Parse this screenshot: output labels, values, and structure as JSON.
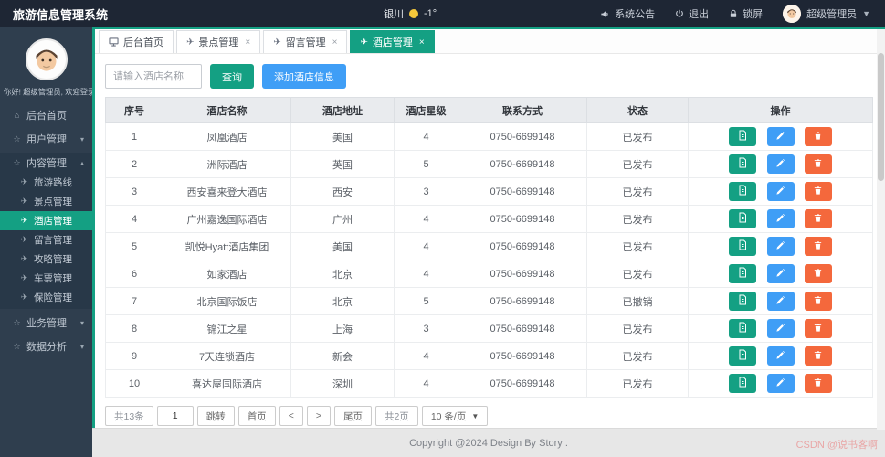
{
  "header": {
    "title": "旅游信息管理系统",
    "city": "银川",
    "weather_icon": "sun",
    "temperature": "-1°",
    "announcement_label": "系统公告",
    "logout_label": "退出",
    "lock_label": "锁屏",
    "username": "超级管理员"
  },
  "sidebar": {
    "greeting": "你好! 超级管理员, 欢迎登录",
    "menu": [
      {
        "label": "后台首页",
        "icon": "home-icon",
        "caret": ""
      },
      {
        "label": "用户管理",
        "icon": "folder-icon",
        "caret": "down"
      },
      {
        "label": "内容管理",
        "icon": "folder-icon",
        "caret": "up",
        "expanded": true,
        "children": [
          {
            "label": "旅游路线",
            "active": false
          },
          {
            "label": "景点管理",
            "active": false
          },
          {
            "label": "酒店管理",
            "active": true
          },
          {
            "label": "留言管理",
            "active": false
          },
          {
            "label": "攻略管理",
            "active": false
          },
          {
            "label": "车票管理",
            "active": false
          },
          {
            "label": "保险管理",
            "active": false
          }
        ]
      },
      {
        "label": "业务管理",
        "icon": "folder-icon",
        "caret": "down"
      },
      {
        "label": "数据分析",
        "icon": "folder-icon",
        "caret": "down"
      }
    ]
  },
  "tabs": [
    {
      "label": "后台首页",
      "icon": "monitor",
      "closable": false,
      "active": false
    },
    {
      "label": "景点管理",
      "icon": "plane",
      "closable": true,
      "active": false
    },
    {
      "label": "留言管理",
      "icon": "plane",
      "closable": true,
      "active": false
    },
    {
      "label": "酒店管理",
      "icon": "plane",
      "closable": true,
      "active": true
    }
  ],
  "toolbar": {
    "search_placeholder": "请输入酒店名称",
    "search_button": "查询",
    "add_button": "添加酒店信息"
  },
  "table": {
    "headers": [
      "序号",
      "酒店名称",
      "酒店地址",
      "酒店星级",
      "联系方式",
      "状态",
      "操作"
    ],
    "rows": [
      {
        "no": "1",
        "name": "凤凰酒店",
        "address": "美国",
        "stars": "4",
        "contact": "0750-6699148",
        "status": "已发布"
      },
      {
        "no": "2",
        "name": "洲际酒店",
        "address": "英国",
        "stars": "5",
        "contact": "0750-6699148",
        "status": "已发布"
      },
      {
        "no": "3",
        "name": "西安喜来登大酒店",
        "address": "西安",
        "stars": "3",
        "contact": "0750-6699148",
        "status": "已发布"
      },
      {
        "no": "4",
        "name": "广州嘉逸国际酒店",
        "address": "广州",
        "stars": "4",
        "contact": "0750-6699148",
        "status": "已发布"
      },
      {
        "no": "5",
        "name": "凯悦Hyatt酒店集团",
        "address": "美国",
        "stars": "4",
        "contact": "0750-6699148",
        "status": "已发布"
      },
      {
        "no": "6",
        "name": "如家酒店",
        "address": "北京",
        "stars": "4",
        "contact": "0750-6699148",
        "status": "已发布"
      },
      {
        "no": "7",
        "name": "北京国际饭店",
        "address": "北京",
        "stars": "5",
        "contact": "0750-6699148",
        "status": "已撤销"
      },
      {
        "no": "8",
        "name": "锦江之星",
        "address": "上海",
        "stars": "3",
        "contact": "0750-6699148",
        "status": "已发布"
      },
      {
        "no": "9",
        "name": "7天连锁酒店",
        "address": "新会",
        "stars": "4",
        "contact": "0750-6699148",
        "status": "已发布"
      },
      {
        "no": "10",
        "name": "喜达屋国际酒店",
        "address": "深圳",
        "stars": "4",
        "contact": "0750-6699148",
        "status": "已发布"
      }
    ]
  },
  "pagination": {
    "total": "共13条",
    "page_value": "1",
    "jump": "跳转",
    "first": "首页",
    "prev": "<",
    "next": ">",
    "last": "尾页",
    "total_pages": "共2页",
    "page_size": "10 条/页"
  },
  "footer": {
    "copyright": "Copyright @2024 Design By Story .",
    "watermark": "CSDN @说书客啊"
  },
  "colors": {
    "accent_teal": "#14a083",
    "button_blue": "#3f9ef6",
    "delete_orange": "#f4683c",
    "header_bg": "#1e2634",
    "sidebar_bg": "#2f3e4e"
  }
}
